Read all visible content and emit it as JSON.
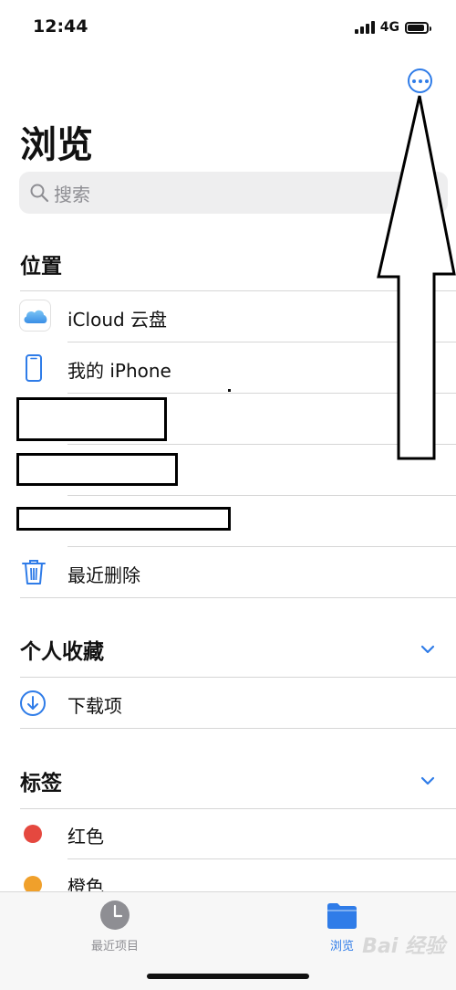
{
  "status": {
    "time": "12:44",
    "network": "4G"
  },
  "header": {
    "title": "浏览"
  },
  "search": {
    "placeholder": "搜索"
  },
  "locations": {
    "title": "位置",
    "items": [
      {
        "label": "iCloud 云盘",
        "icon": "icloud-icon"
      },
      {
        "label": "我的 iPhone",
        "icon": "iphone-icon"
      },
      {
        "label": "最近删除",
        "icon": "trash-icon"
      }
    ]
  },
  "favorites": {
    "title": "个人收藏",
    "items": [
      {
        "label": "下载项",
        "icon": "download-icon"
      }
    ]
  },
  "tags": {
    "title": "标签",
    "items": [
      {
        "label": "红色",
        "color": "#e5483f"
      },
      {
        "label": "橙色",
        "color": "#f0a02b"
      }
    ]
  },
  "tabbar": {
    "recents": {
      "label": "最近项目",
      "icon": "clock-icon"
    },
    "browse": {
      "label": "浏览",
      "icon": "folder-icon"
    }
  },
  "colors": {
    "accent": "#2f7ce8"
  },
  "watermark": "Bai 经验"
}
